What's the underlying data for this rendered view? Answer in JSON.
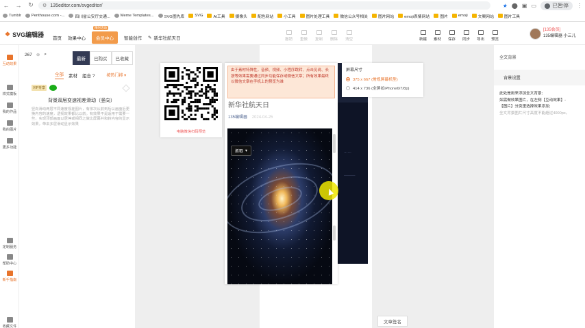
{
  "browser": {
    "url": "135editor.com/svgeditor/",
    "profile_label": "已暂停",
    "bookmarks": [
      "Tumblr",
      "Penthouse.com -...",
      "四川省公安厅交通...",
      "Meme Templates...",
      "SVG图先库",
      "SVG",
      "AI工具",
      "摄像头",
      "配色网站",
      "小工具",
      "图片处理工具",
      "微信公众号相关",
      "图片网站",
      "emoji表情网站",
      "图片",
      "emoji",
      "文案网站",
      "图片工具"
    ]
  },
  "header": {
    "logo": "SVG编辑器",
    "nav": [
      "首页",
      "效果中心",
      "会员中心",
      "智能创作"
    ],
    "member_tag": "限时活动",
    "doc_title": "新华社航天日",
    "tools_disabled": [
      "撤销",
      "重做",
      "复制",
      "删除",
      "清空"
    ],
    "tools_right": [
      "新建",
      "素材",
      "保存",
      "同步",
      "导出",
      "预览"
    ],
    "user_vip": "[135会员]",
    "user_name": "135编辑器 小三儿"
  },
  "rail": [
    "互动效果",
    "样式模板",
    "我的作品",
    "我的图片",
    "更多功能",
    "定制服务",
    "帮助中心",
    "新手指南",
    "收藏文件"
  ],
  "panel": {
    "search_value": "267",
    "filter_tabs": [
      "最新",
      "已购买",
      "已收藏"
    ],
    "sub_tabs": [
      "全部",
      "素材",
      "组合"
    ],
    "sort_label": "按热门排 ▾",
    "vip_tag": "VIP专享",
    "card_title": "背景双层变速视差滑动（竖向）",
    "card_desc": "竖向滑动两层不同速度视差图片，有依次从前到后以画面后更换内容的速度，透视效果都比以前。有效果不是适用于需要一些，实现顶部画面以居停或相同之做比屏幕并和转内容的显示效果，带来多层滑动显示效果"
  },
  "preview": {
    "qr_caption": "电脑微信扫码预览",
    "notice": "由于素材特殊性，音频、视频、小程序跳转、点击见说、长按等效果需要通过同步功能保存或微信文章；所有效果最终以微信文章在手机上的预览为准",
    "article_title": "新华社航天日",
    "author": "135编辑器",
    "date": "2024-04-25",
    "capture_label": "抓取",
    "screen_size_label": "屏幕尺寸",
    "size_options": [
      "375 x 667 (常规屏幕机型)",
      "414 x 736 (全屏如iPhone6/7/8p)"
    ],
    "selected_size": 0
  },
  "canvas": {
    "footer_button": "文章签名"
  },
  "right_panel": {
    "title": "全文背景",
    "sub_title": "背景设置",
    "body": [
      "此处是用来添加全文背景;",
      "如需做效果图片，在左侧【互动效果】-",
      "【图片】分类里选择效果添加;",
      "全文背景图片尺寸高度不能超过4000px。"
    ]
  },
  "colors": {
    "accent": "#e8742b",
    "nav_active": "#333a54",
    "notice_bg": "#fde7d7"
  }
}
